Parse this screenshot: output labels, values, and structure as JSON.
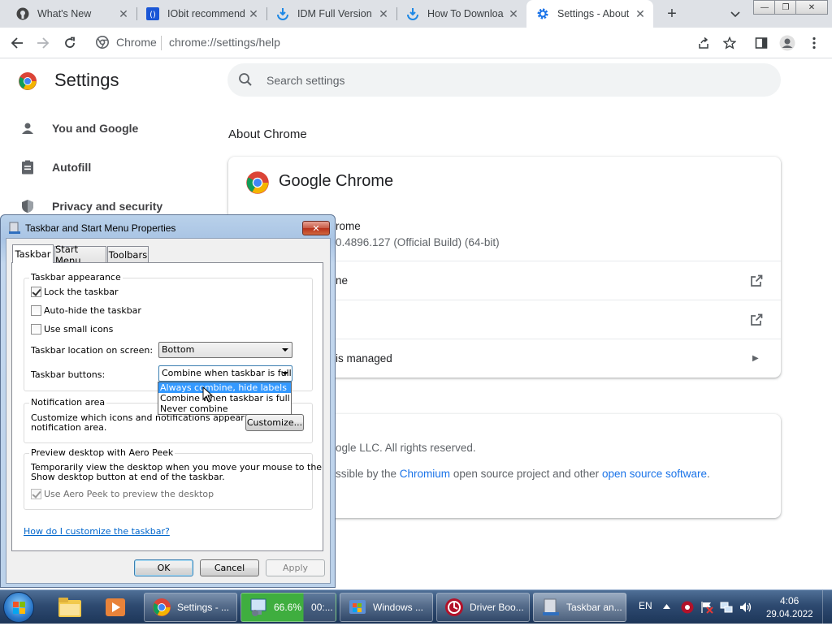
{
  "tabs": [
    {
      "label": "What's New"
    },
    {
      "label": "IObit recommend"
    },
    {
      "label": "IDM Full Version"
    },
    {
      "label": "How To Downloa"
    },
    {
      "label": "Settings - About"
    }
  ],
  "omnibox": {
    "site": "Chrome",
    "url": "chrome://settings/help"
  },
  "settings": {
    "title": "Settings",
    "search_placeholder": "Search settings",
    "nav": [
      {
        "label": "You and Google"
      },
      {
        "label": "Autofill"
      },
      {
        "label": "Privacy and security"
      }
    ],
    "about_heading": "About Chrome",
    "product_title": "Google Chrome",
    "rows": {
      "update_status": "rome",
      "version": "0.4896.127 (Official Build) (64-bit)",
      "help_row": "ne",
      "managed_row": "is managed"
    },
    "footer": {
      "copyright": "ogle LLC. All rights reserved.",
      "credits_prefix": "ssible by the ",
      "chromium_link": "Chromium",
      "credits_middle": " open source project and other ",
      "oss_link": "open source software",
      "credits_suffix": "."
    }
  },
  "dialog": {
    "title": "Taskbar and Start Menu Properties",
    "close_label": "✕",
    "tabs": [
      "Taskbar",
      "Start Menu",
      "Toolbars"
    ],
    "appearance_group": "Taskbar appearance",
    "lock_taskbar": "Lock the taskbar",
    "auto_hide": "Auto-hide the taskbar",
    "small_icons": "Use small icons",
    "location_label": "Taskbar location on screen:",
    "location_value": "Bottom",
    "buttons_label": "Taskbar buttons:",
    "buttons_value": "Combine when taskbar is full",
    "buttons_options": [
      "Always combine, hide labels",
      "Combine when taskbar is full",
      "Never combine"
    ],
    "notification_group": "Notification area",
    "notification_text1": "Customize which icons and notifications appear in the",
    "notification_text2": "notification area.",
    "customize_button": "Customize...",
    "aero_group": "Preview desktop with Aero Peek",
    "aero_text1": "Temporarily view the desktop when you move your mouse to the",
    "aero_text2": "Show desktop button at end of the taskbar.",
    "aero_checkbox": "Use Aero Peek to preview the desktop",
    "help_link": "How do I customize the taskbar?",
    "ok": "OK",
    "cancel": "Cancel",
    "apply": "Apply"
  },
  "taskbar": {
    "buttons": [
      {
        "label": "Settings - ..."
      },
      {
        "label": "66.6%",
        "extra": "00:..."
      },
      {
        "label": "Windows ..."
      },
      {
        "label": "Driver Boo..."
      },
      {
        "label": "Taskbar an..."
      }
    ],
    "language": "EN",
    "time": "4:06",
    "date": "29.04.2022"
  }
}
